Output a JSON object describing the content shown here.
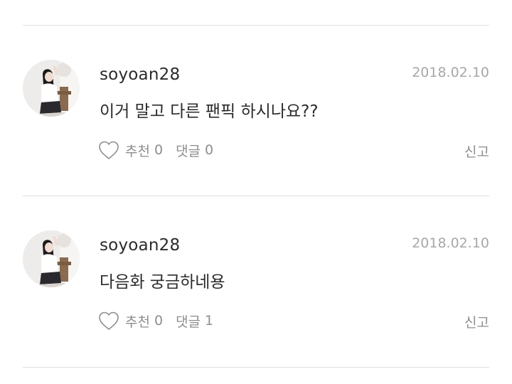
{
  "comments": [
    {
      "username": "soyoan28",
      "date": "2018.02.10",
      "text": "이거 말고 다른 팬픽 하시나요??",
      "like_label": "추천",
      "like_count": "0",
      "reply_label": "댓글",
      "reply_count": "0",
      "report_label": "신고"
    },
    {
      "username": "soyoan28",
      "date": "2018.02.10",
      "text": "다음화 궁금하네용",
      "like_label": "추천",
      "like_count": "0",
      "reply_label": "댓글",
      "reply_count": "1",
      "report_label": "신고"
    }
  ],
  "colors": {
    "text": "#2b2b2b",
    "muted": "#8e8e8e",
    "date": "#a7a7a7",
    "divider": "#dedede"
  },
  "icons": {
    "like": "heart-outline-icon"
  }
}
